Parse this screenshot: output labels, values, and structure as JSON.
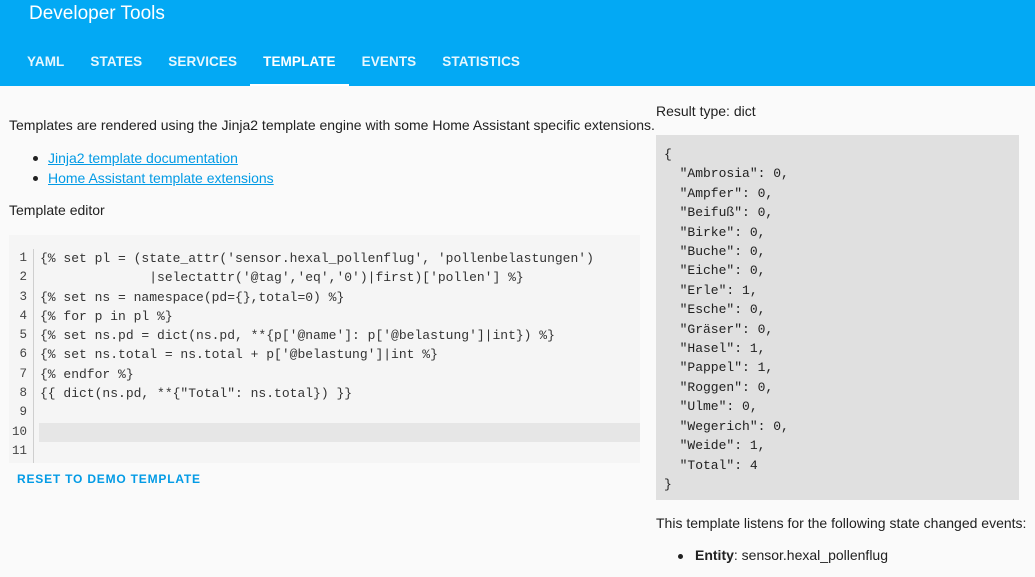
{
  "app": {
    "title": "Developer Tools"
  },
  "tabs": [
    {
      "label": "YAML",
      "active": false
    },
    {
      "label": "STATES",
      "active": false
    },
    {
      "label": "SERVICES",
      "active": false
    },
    {
      "label": "TEMPLATE",
      "active": true
    },
    {
      "label": "EVENTS",
      "active": false
    },
    {
      "label": "STATISTICS",
      "active": false
    }
  ],
  "intro": {
    "text": "Templates are rendered using the Jinja2 template engine with some Home Assistant specific extensions.",
    "links": [
      "Jinja2 template documentation",
      "Home Assistant template extensions"
    ]
  },
  "editor": {
    "label": "Template editor",
    "line_numbers": [
      "1",
      "2",
      "3",
      "4",
      "5",
      "6",
      "7",
      "8",
      "9",
      "10",
      "11"
    ],
    "lines": [
      "{% set pl = (state_attr('sensor.hexal_pollenflug', 'pollenbelastungen')",
      "              |selectattr('@tag','eq','0')|first)['pollen'] %}",
      "{% set ns = namespace(pd={},total=0) %}",
      "{% for p in pl %}",
      "{% set ns.pd = dict(ns.pd, **{p['@name']: p['@belastung']|int}) %}",
      "{% set ns.total = ns.total + p['@belastung']|int %}",
      "{% endfor %}",
      "{{ dict(ns.pd, **{\"Total\": ns.total}) }}",
      "",
      "",
      ""
    ],
    "reset_label": "RESET TO DEMO TEMPLATE"
  },
  "result": {
    "type_label": "Result type: dict",
    "output": "{\n  \"Ambrosia\": 0,\n  \"Ampfer\": 0,\n  \"Beifuß\": 0,\n  \"Birke\": 0,\n  \"Buche\": 0,\n  \"Eiche\": 0,\n  \"Erle\": 1,\n  \"Esche\": 0,\n  \"Gräser\": 0,\n  \"Hasel\": 1,\n  \"Pappel\": 1,\n  \"Roggen\": 0,\n  \"Ulme\": 0,\n  \"Wegerich\": 0,\n  \"Weide\": 1,\n  \"Total\": 4\n}",
    "listens_text": "This template listens for the following state changed events:",
    "entity_label": "Entity",
    "entity_value": ": sensor.hexal_pollenflug"
  }
}
